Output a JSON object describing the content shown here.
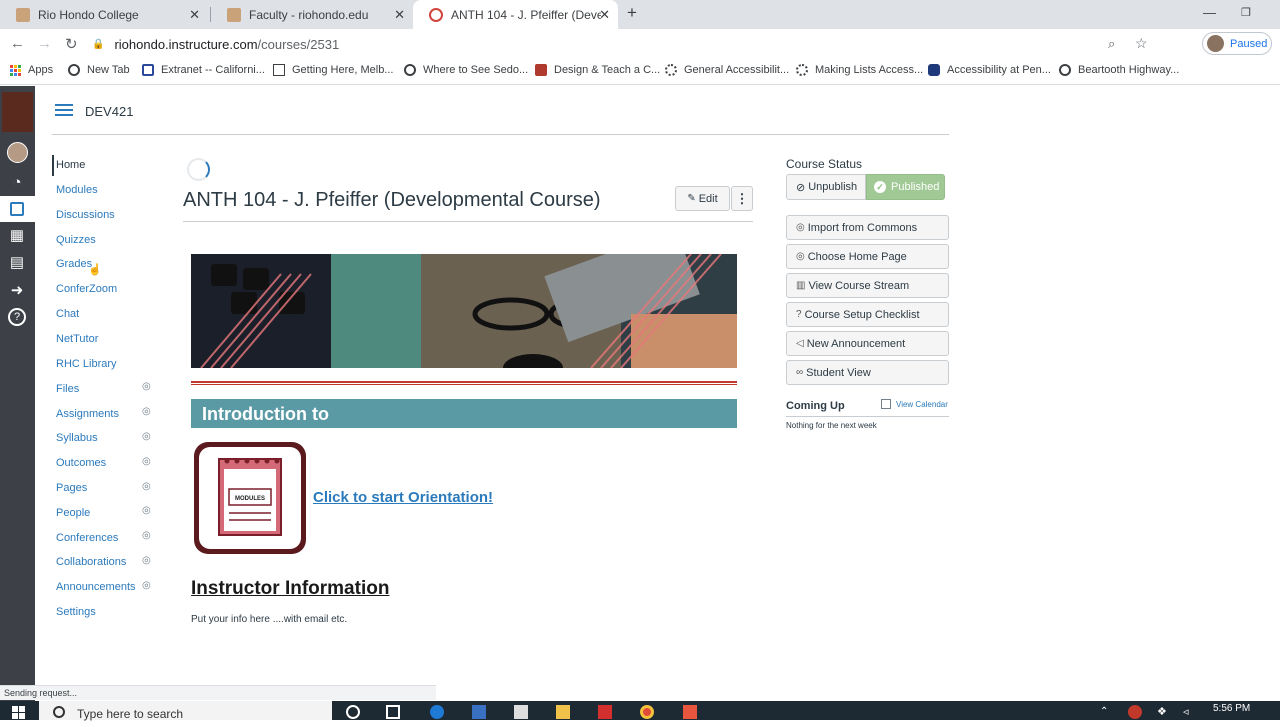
{
  "browser": {
    "tabs": [
      {
        "title": "Rio Hondo College"
      },
      {
        "title": "Faculty - riohondo.edu"
      },
      {
        "title": "ANTH 104 - J. Pfeiffer (Developm"
      }
    ],
    "url_host": "riohondo.instructure.com",
    "url_path": "/courses/2531",
    "profile_status": "Paused",
    "bookmarks": [
      "Apps",
      "New Tab",
      "Extranet -- Californi...",
      "Getting Here, Melb...",
      "Where to See Sedo...",
      "Design & Teach a C...",
      "General Accessibilit...",
      "Making Lists Access...",
      "Accessibility at Pen...",
      "Beartooth Highway..."
    ],
    "status_text": "Sending request..."
  },
  "course": {
    "code": "DEV421",
    "nav": [
      "Home",
      "Modules",
      "Discussions",
      "Quizzes",
      "Grades",
      "ConferZoom",
      "Chat",
      "NetTutor",
      "RHC Library",
      "Files",
      "Assignments",
      "Syllabus",
      "Outcomes",
      "Pages",
      "People",
      "Conferences",
      "Collaborations",
      "Announcements",
      "Settings"
    ],
    "title": "ANTH 104 - J. Pfeiffer (Developmental Course)",
    "edit_label": "Edit",
    "more_label": "⋮",
    "intro_heading": "Introduction to",
    "module_icon_text": "MODULES",
    "orientation_link": "Click to start Orientation!",
    "instructor_heading": "Instructor Information",
    "instructor_body": "Put your info here ....with email etc."
  },
  "sidebar": {
    "status_title": "Course Status",
    "unpublish": "Unpublish",
    "published": "Published",
    "buttons": [
      "Import from Commons",
      "Choose Home Page",
      "View Course Stream",
      "Course Setup Checklist",
      "New Announcement",
      "Student View"
    ],
    "coming_up": "Coming Up",
    "view_calendar": "View Calendar",
    "nothing": "Nothing for the next week"
  },
  "taskbar": {
    "search_placeholder": "Type here to search",
    "time": "5:56 PM"
  },
  "colors": {
    "link": "#2b7abc",
    "intro_bar": "#5a9aa5",
    "published": "#a0c995",
    "global_nav": "#3d4147"
  }
}
